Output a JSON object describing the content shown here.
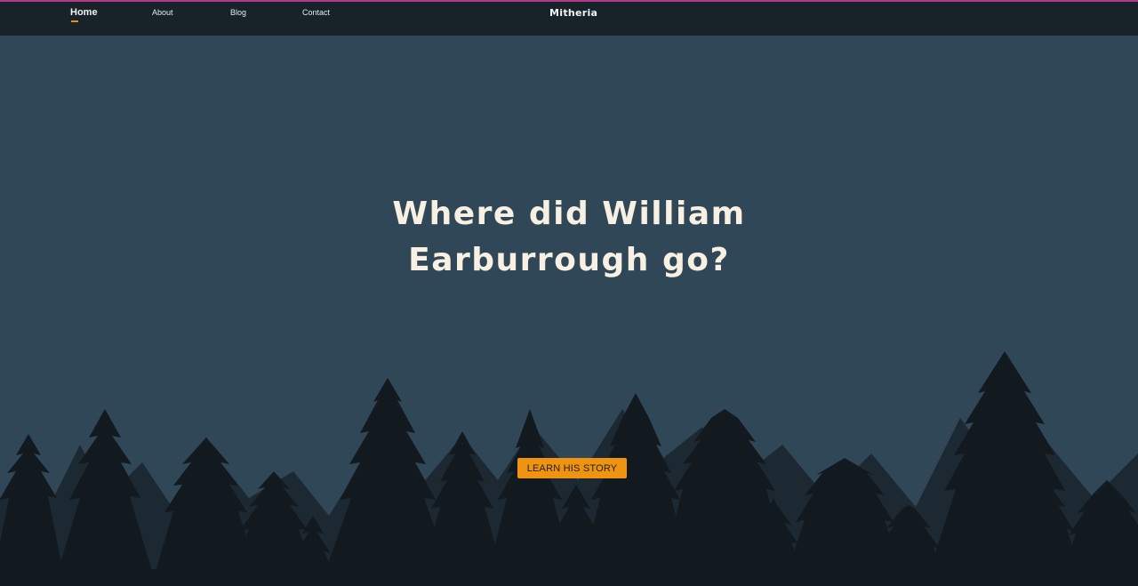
{
  "nav": {
    "links": [
      {
        "label": "Home",
        "active": true
      },
      {
        "label": "About",
        "active": false
      },
      {
        "label": "Blog",
        "active": false
      },
      {
        "label": "Contact",
        "active": false
      }
    ],
    "brand": "Mitheria"
  },
  "hero": {
    "title_line1": "Where did William",
    "title_line2": "Earburrough go?",
    "cta_label": "LEARN HIS STORY"
  },
  "colors": {
    "accent": "#ee9410",
    "nav_background": "#172229",
    "hero_background": "#2f4757",
    "title_text": "#f7f0e3",
    "tree_silhouette": "#111619"
  }
}
